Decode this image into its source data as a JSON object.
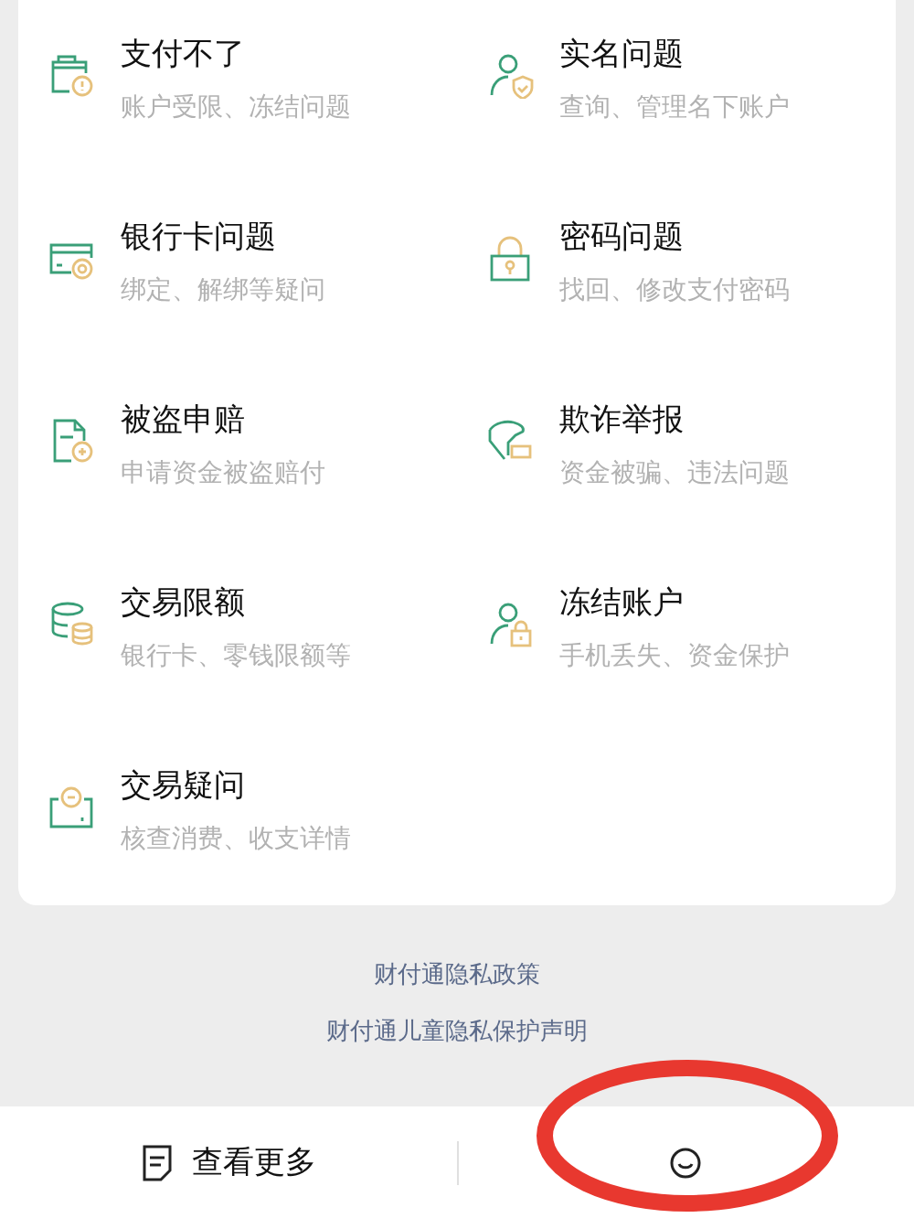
{
  "topics": [
    {
      "title": "支付不了",
      "subtitle": "账户受限、冻结问题"
    },
    {
      "title": "实名问题",
      "subtitle": "查询、管理名下账户"
    },
    {
      "title": "银行卡问题",
      "subtitle": "绑定、解绑等疑问"
    },
    {
      "title": "密码问题",
      "subtitle": "找回、修改支付密码"
    },
    {
      "title": "被盗申赔",
      "subtitle": "申请资金被盗赔付"
    },
    {
      "title": "欺诈举报",
      "subtitle": "资金被骗、违法问题"
    },
    {
      "title": "交易限额",
      "subtitle": "银行卡、零钱限额等"
    },
    {
      "title": "冻结账户",
      "subtitle": "手机丢失、资金保护"
    },
    {
      "title": "交易疑问",
      "subtitle": "核查消费、收支详情"
    }
  ],
  "footer_links": [
    "财付通隐私政策",
    "财付通儿童隐私保护声明"
  ],
  "bottom_bar": {
    "more_label": "查看更多"
  }
}
